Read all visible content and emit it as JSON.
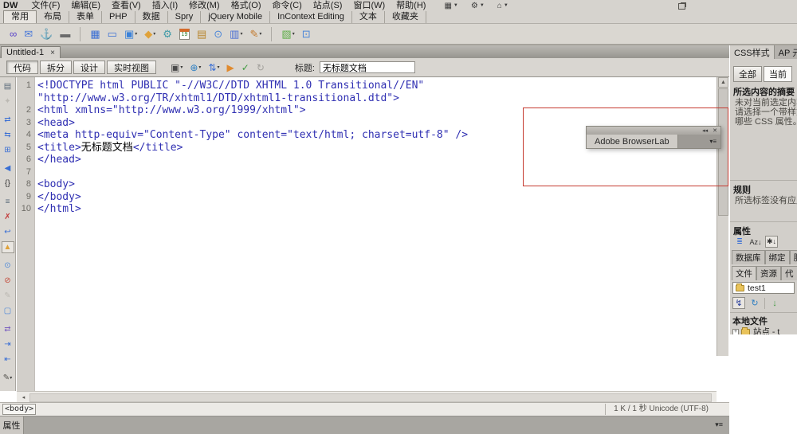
{
  "colors": {
    "code_blue": "#2f2fb2",
    "annotation_red": "#c53a30",
    "chrome_gray": "#d6d3ce"
  },
  "menu_bar": {
    "logo": "DW",
    "items": [
      "文件(F)",
      "编辑(E)",
      "查看(V)",
      "插入(I)",
      "修改(M)",
      "格式(O)",
      "命令(C)",
      "站点(S)",
      "窗口(W)",
      "帮助(H)"
    ],
    "right_icons": [
      {
        "name": "workspace-layout-icon",
        "glyph": "▦"
      },
      {
        "name": "extensions-gear-icon",
        "glyph": "⚙"
      },
      {
        "name": "site-menu-icon",
        "glyph": "⌂"
      }
    ],
    "dropdown_glyph": "▼"
  },
  "insert_tab_bar": {
    "active_index": 0,
    "items": [
      "常用",
      "布局",
      "表单",
      "PHP",
      "数据",
      "Spry",
      "jQuery Mobile",
      "InContext Editing",
      "文本",
      "收藏夹"
    ]
  },
  "insert_toolbar": {
    "icons": [
      {
        "name": "hyperlink-icon",
        "glyph": "∞",
        "color": "#5a43c9"
      },
      {
        "name": "email-link-icon",
        "glyph": "✉",
        "color": "#4a79d9"
      },
      {
        "name": "named-anchor-icon",
        "glyph": "⚓",
        "color": "#d79b2e"
      },
      {
        "name": "horizontal-rule-icon",
        "glyph": "▬",
        "color": "#6a6a6a",
        "sep_after": true
      },
      {
        "name": "table-icon",
        "glyph": "▦",
        "color": "#3b6fd4"
      },
      {
        "name": "insert-div-icon",
        "glyph": "▭",
        "color": "#3b6fd4"
      },
      {
        "name": "image-icon",
        "glyph": "▣",
        "color": "#3b82d9",
        "dropdown": true
      },
      {
        "name": "media-icon",
        "glyph": "◆",
        "color": "#e0a23a",
        "dropdown": true
      },
      {
        "name": "widget-icon",
        "glyph": "⚙",
        "color": "#3f9ba8"
      },
      {
        "name": "date-icon",
        "glyph": "19",
        "color": "#2a7a2a",
        "calendar": true
      },
      {
        "name": "server-include-icon",
        "glyph": "▤",
        "color": "#b8862f"
      },
      {
        "name": "comment-icon",
        "glyph": "⊙",
        "color": "#4a86d9"
      },
      {
        "name": "head-icon",
        "glyph": "▥",
        "color": "#4a6fd4",
        "dropdown": true
      },
      {
        "name": "script-icon",
        "glyph": "✎",
        "color": "#c27a2e",
        "dropdown": true,
        "sep_after": true
      },
      {
        "name": "template-icon",
        "glyph": "▧",
        "color": "#5fae4a",
        "dropdown": true
      },
      {
        "name": "tag-chooser-icon",
        "glyph": "⊡",
        "color": "#4a86d9"
      }
    ]
  },
  "doc": {
    "tab_title": "Untitled-1",
    "close_glyph": "×"
  },
  "doc_toolbar": {
    "view_buttons": [
      "代码",
      "拆分",
      "设计",
      "实时视图"
    ],
    "active_index": 0,
    "icons": [
      {
        "name": "multiscreen-icon",
        "glyph": "▣",
        "color": "#4a4a4a",
        "dropdown": true
      },
      {
        "name": "preview-in-browser-icon",
        "glyph": "⊕",
        "color": "#2e7fc2",
        "dropdown": true
      },
      {
        "name": "file-management-icon",
        "glyph": "⇅",
        "color": "#3a6fd4",
        "dropdown": true
      },
      {
        "name": "live-code-icon",
        "glyph": "▶",
        "color": "#e08a2e"
      },
      {
        "name": "check-browser-compatibility-icon",
        "glyph": "✓",
        "color": "#3f9a3f"
      },
      {
        "name": "refresh-icon",
        "glyph": "↻",
        "color": "#a3a19c"
      }
    ],
    "title_label": "标题:",
    "title_value": "无标题文档"
  },
  "coding_toolbar": {
    "icons": [
      {
        "name": "open-documents-icon",
        "glyph": "▤",
        "color": "#5a6a7a"
      },
      {
        "name": "show-code-navigator-icon",
        "glyph": "✦",
        "color": "#bcb9b3"
      },
      {
        "name": "collapse-full-tag-icon",
        "glyph": "⇄",
        "color": "#3a6fd4",
        "gap": true
      },
      {
        "name": "collapse-selection-icon",
        "glyph": "⇆",
        "color": "#3a6fd4"
      },
      {
        "name": "expand-all-icon",
        "glyph": "⊞",
        "color": "#3a6fd4"
      },
      {
        "name": "select-parent-tag-icon",
        "glyph": "◀",
        "color": "#3a6fd4",
        "gap": true
      },
      {
        "name": "balance-braces-icon",
        "glyph": "{}",
        "color": "#333333"
      },
      {
        "name": "line-numbers-icon",
        "glyph": "≡",
        "color": "#5a6a7a",
        "gap": true
      },
      {
        "name": "highlight-invalid-code-icon",
        "glyph": "✗",
        "color": "#c23a3a"
      },
      {
        "name": "word-wrap-icon",
        "glyph": "↩",
        "color": "#3a6fd4"
      },
      {
        "name": "syntax-error-alerts-icon",
        "glyph": "▲",
        "color": "#e0a23a",
        "pressed": true
      },
      {
        "name": "apply-comment-icon",
        "glyph": "⊙",
        "color": "#4a86d9",
        "gap": true
      },
      {
        "name": "remove-comment-icon",
        "glyph": "⊘",
        "color": "#c34a3a"
      },
      {
        "name": "wrap-tag-icon",
        "glyph": "✎",
        "color": "#bcb9b3"
      },
      {
        "name": "recent-snippets-icon",
        "glyph": "▢",
        "color": "#4a86d9"
      },
      {
        "name": "move-css-icon",
        "glyph": "⇄",
        "color": "#7a5fc0",
        "gap": true
      },
      {
        "name": "indent-code-icon",
        "glyph": "⇥",
        "color": "#3a6fd4"
      },
      {
        "name": "outdent-code-icon",
        "glyph": "⇤",
        "color": "#3a6fd4"
      },
      {
        "name": "format-source-code-icon",
        "glyph": "✎",
        "color": "#55534e",
        "dropdown": true,
        "gap": true
      }
    ]
  },
  "code": {
    "rows": [
      {
        "num": "1",
        "segs": [
          {
            "c": "tag",
            "t": "<!DOCTYPE html PUBLIC \"-//W3C//DTD XHTML 1.0 Transitional//EN\""
          }
        ]
      },
      {
        "num": "",
        "segs": [
          {
            "c": "tag",
            "t": "\"http://www.w3.org/TR/xhtml1/DTD/xhtml1-transitional.dtd\">"
          }
        ]
      },
      {
        "num": "2",
        "segs": [
          {
            "c": "tag",
            "t": "<html xmlns=\"http://www.w3.org/1999/xhtml\">"
          }
        ]
      },
      {
        "num": "3",
        "segs": [
          {
            "c": "tag",
            "t": "<head>"
          }
        ]
      },
      {
        "num": "4",
        "segs": [
          {
            "c": "tag",
            "t": "<meta http-equiv=\"Content-Type\" content=\"text/html; charset=utf-8\" />"
          }
        ]
      },
      {
        "num": "5",
        "segs": [
          {
            "c": "tag",
            "t": "<title>"
          },
          {
            "c": "plain",
            "t": "无标题文档"
          },
          {
            "c": "tag",
            "t": "</title>"
          }
        ]
      },
      {
        "num": "6",
        "segs": [
          {
            "c": "tag",
            "t": "</head>"
          }
        ]
      },
      {
        "num": "7",
        "segs": []
      },
      {
        "num": "8",
        "segs": [
          {
            "c": "tag",
            "t": "<body>"
          }
        ]
      },
      {
        "num": "9",
        "segs": [
          {
            "c": "tag",
            "t": "</body>"
          }
        ]
      },
      {
        "num": "10",
        "segs": [
          {
            "c": "tag",
            "t": "</html>"
          }
        ]
      }
    ]
  },
  "scroll": {
    "up": "▲",
    "down": "▼",
    "left": "◂",
    "right": "▸"
  },
  "browserlab": {
    "tab": "Adobe BrowserLab",
    "collapse_glyph": "◂◂",
    "close_glyph": "✕",
    "menu_glyph": "▾≡"
  },
  "css_panel": {
    "tabs": [
      "CSS样式",
      "AP 元"
    ],
    "mode_buttons": [
      "全部",
      "当前"
    ],
    "summary_title": "所选内容的摘要",
    "summary_lines": [
      "未对当前选定内容",
      "请选择一个带样式",
      "哪些 CSS 属性。"
    ],
    "rules_title": "规则",
    "rules_text": "所选标签没有应用",
    "props_title": "属性",
    "sort_buttons": [
      {
        "name": "show-category-view-icon",
        "glyph": "≣",
        "color": "#3a6fd4"
      },
      {
        "name": "sort-az-icon",
        "glyph": "Az↓",
        "color": "#333333"
      },
      {
        "name": "sort-set-icon",
        "glyph": "✱↓",
        "color": "#333333",
        "pressed": true
      }
    ]
  },
  "app_panel": {
    "tabs": [
      "数据库",
      "绑定",
      "服"
    ]
  },
  "files_panel": {
    "tabs": [
      "文件",
      "资源",
      "代"
    ],
    "site_name": "test1",
    "toolbar_icons": [
      {
        "name": "connect-icon",
        "glyph": "↯",
        "color": "#2a3f9a",
        "pressed": true
      },
      {
        "name": "refresh-icon",
        "glyph": "↻",
        "color": "#2e7fc2"
      },
      {
        "name": "get-file-icon",
        "glyph": "↓",
        "color": "#3f9a3f",
        "sep_before": true
      }
    ],
    "local_header": "本地文件",
    "tree_plus": "+",
    "tree_item": "站点 - t"
  },
  "statusbar": {
    "tag": "<body>",
    "stats": "1 K / 1 秒 Unicode (UTF-8)"
  },
  "props_bar": {
    "label": "属性",
    "menu_glyph": "▾≡"
  }
}
